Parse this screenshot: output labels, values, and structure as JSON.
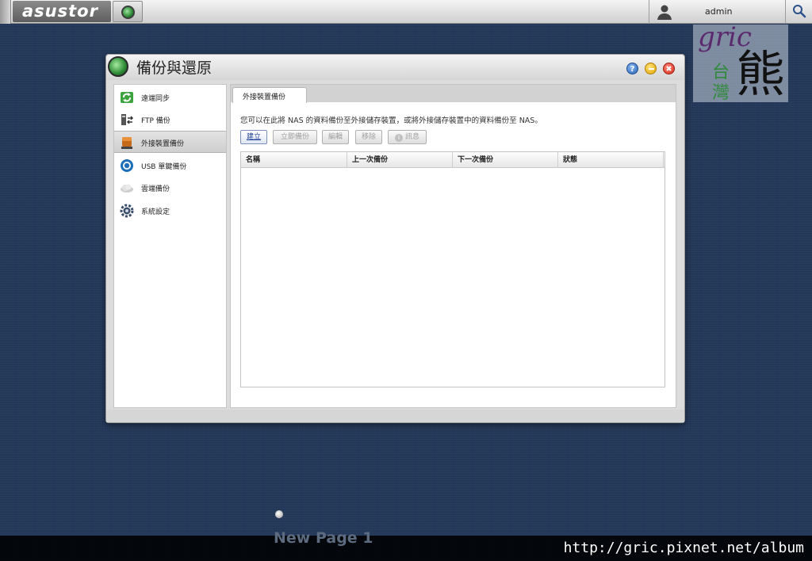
{
  "topbar": {
    "brand": "asustor",
    "username": "admin"
  },
  "watermark": {
    "script": "gric",
    "char_a": "台",
    "char_b": "灣",
    "char_bear": "熊"
  },
  "dialog": {
    "title": "備份與還原",
    "help_label": "?"
  },
  "sidebar": {
    "items": [
      {
        "label": "遠端同步",
        "icon": "sync-icon"
      },
      {
        "label": "FTP 備份",
        "icon": "ftp-icon"
      },
      {
        "label": "外接裝置備份",
        "icon": "external-drive-icon",
        "active": true
      },
      {
        "label": "USB 單鍵備份",
        "icon": "usb-button-icon"
      },
      {
        "label": "雲端備份",
        "icon": "cloud-icon"
      },
      {
        "label": "系統設定",
        "icon": "gear-icon"
      }
    ]
  },
  "main": {
    "tab_label": "外接裝置備份",
    "description": "您可以在此將 NAS 的資料備份至外接儲存裝置，或將外接儲存裝置中的資料備份至 NAS。",
    "buttons": {
      "create": "建立",
      "backup_now": "立即備份",
      "edit": "編輯",
      "remove": "移除",
      "info": "訊息"
    },
    "columns": [
      "名稱",
      "上一次備份",
      "下一次備份",
      "狀態"
    ]
  },
  "bottom": {
    "page_label": "New Page 1",
    "footer_url": "http://gric.pixnet.net/album"
  }
}
